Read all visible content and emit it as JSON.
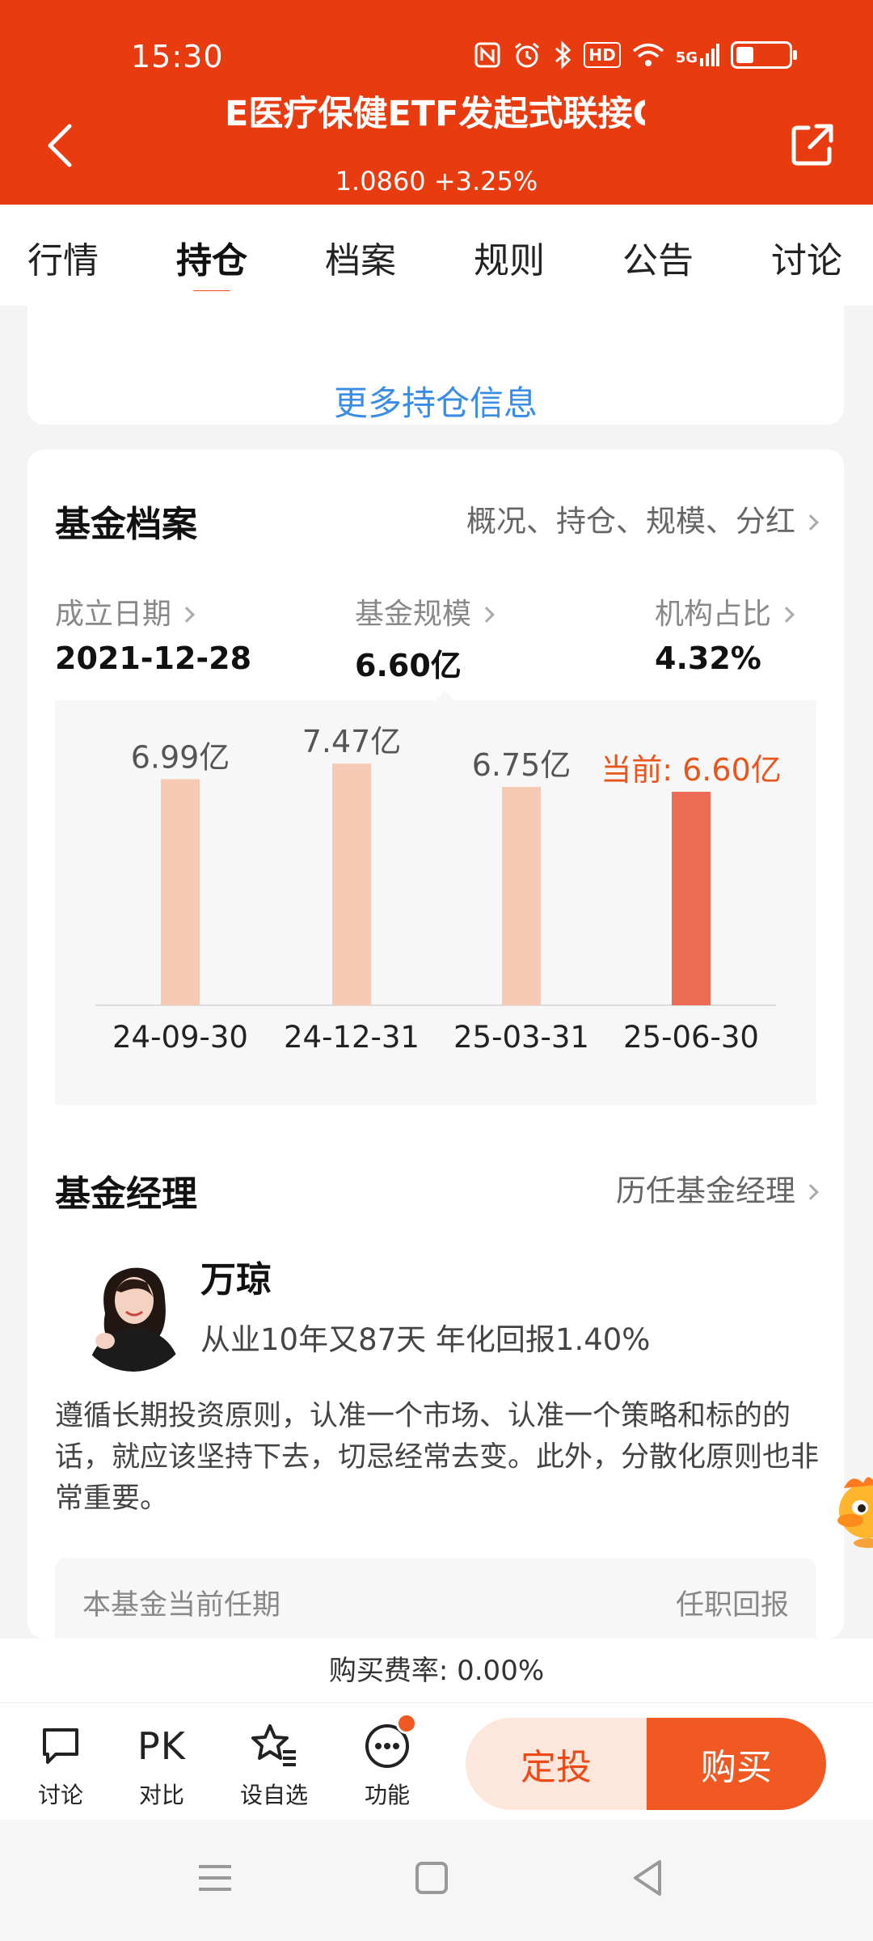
{
  "status_bar": {
    "time": "15:30",
    "network": "5G",
    "hd": "HD",
    "battery_level": 0.3
  },
  "header": {
    "title": "E医疗保健ETF发起式联接C",
    "price": "1.0860",
    "change": "+3.25%"
  },
  "tabs": [
    "行情",
    "持仓",
    "档案",
    "规则",
    "公告",
    "讨论"
  ],
  "active_tab": "持仓",
  "holdings": {
    "more_link": "更多持仓信息"
  },
  "fund_profile": {
    "title": "基金档案",
    "link": "概况、持仓、规模、分红",
    "stats": [
      {
        "label": "成立日期",
        "value": "2021-12-28"
      },
      {
        "label": "基金规模",
        "value": "6.60亿"
      },
      {
        "label": "机构占比",
        "value": "4.32%"
      }
    ]
  },
  "chart_data": {
    "type": "bar",
    "categories": [
      "24-09-30",
      "24-12-31",
      "25-03-31",
      "25-06-30"
    ],
    "values": [
      6.99,
      7.47,
      6.75,
      6.6
    ],
    "value_labels": [
      "6.99亿",
      "7.47亿",
      "6.75亿",
      "当前: 6.60亿"
    ],
    "unit": "亿",
    "highlight_index": 3,
    "colors": {
      "normal": "#f6c9b4",
      "highlight": "#eb6c55",
      "highlight_label": "#e8561e"
    }
  },
  "fund_manager": {
    "title": "基金经理",
    "link": "历任基金经理",
    "name": "万琼",
    "info": "从业10年又87天 年化回报1.40%",
    "quote": "遵循长期投资原则，认准一个市场、认准一个策略和标的的话，就应该坚持下去，切忌经常去变。此外，分散化原则也非常重要。",
    "tenure_label": "本基金当前任期",
    "tenure_return_label": "任职回报"
  },
  "fee": {
    "text": "购买费率: 0.00%"
  },
  "bottom_actions": [
    {
      "icon": "chat-icon",
      "label": "讨论"
    },
    {
      "icon": "pk-icon",
      "label": "对比",
      "text": "PK"
    },
    {
      "icon": "star-list-icon",
      "label": "设自选"
    },
    {
      "icon": "more-icon",
      "label": "功能"
    }
  ],
  "buttons": {
    "dingtou": "定投",
    "buy": "购买"
  },
  "theme": {
    "brand": "#e83b0f",
    "accent": "#f05a22",
    "link": "#3a8de6"
  }
}
